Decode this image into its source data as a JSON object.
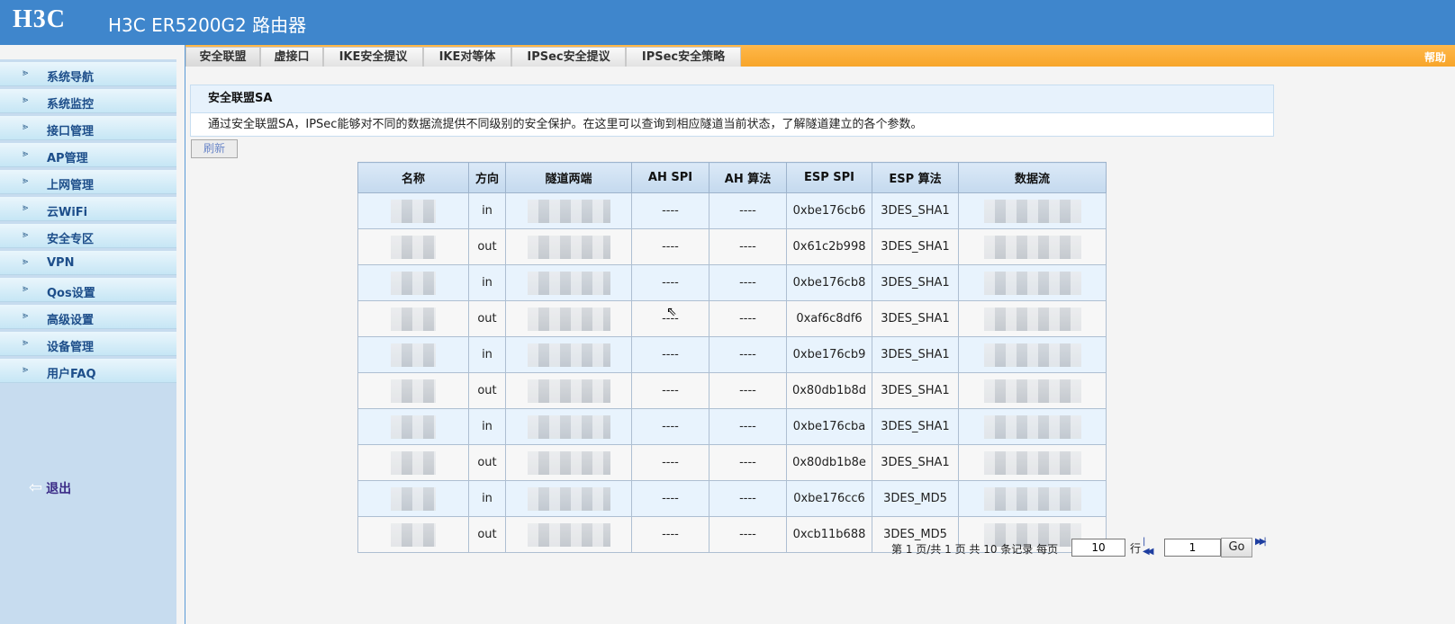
{
  "header": {
    "logo": "H3C",
    "title": "H3C ER5200G2 路由器"
  },
  "sidebar": {
    "items": [
      {
        "label": "系统导航"
      },
      {
        "label": "系统监控"
      },
      {
        "label": "接口管理"
      },
      {
        "label": "AP管理"
      },
      {
        "label": "上网管理"
      },
      {
        "label": "云WiFi"
      },
      {
        "label": "安全专区"
      },
      {
        "label": "VPN"
      },
      {
        "label": "Qos设置"
      },
      {
        "label": "高级设置"
      },
      {
        "label": "设备管理"
      },
      {
        "label": "用户FAQ"
      }
    ],
    "logout_label": "退出",
    "logout_icon": "logout-icon"
  },
  "tabs": {
    "items": [
      {
        "label": "安全联盟",
        "active": true
      },
      {
        "label": "虚接口"
      },
      {
        "label": "IKE安全提议"
      },
      {
        "label": "IKE对等体"
      },
      {
        "label": "IPSec安全提议"
      },
      {
        "label": "IPSec安全策略"
      }
    ],
    "help": "帮助"
  },
  "sa": {
    "title": "安全联盟SA",
    "description": "通过安全联盟SA，IPSec能够对不同的数据流提供不同级别的安全保护。在这里可以查询到相应隧道当前状态，了解隧道建立的各个参数。",
    "refresh": "刷新"
  },
  "table": {
    "headers": [
      "名称",
      "方向",
      "隧道两端",
      "AH SPI",
      "AH 算法",
      "ESP SPI",
      "ESP 算法",
      "数据流"
    ],
    "rows": [
      {
        "direction": "in",
        "ah_spi": "----",
        "ah_alg": "----",
        "esp_spi": "0xbe176cb6",
        "esp_alg": "3DES_SHA1"
      },
      {
        "direction": "out",
        "ah_spi": "----",
        "ah_alg": "----",
        "esp_spi": "0x61c2b998",
        "esp_alg": "3DES_SHA1"
      },
      {
        "direction": "in",
        "ah_spi": "----",
        "ah_alg": "----",
        "esp_spi": "0xbe176cb8",
        "esp_alg": "3DES_SHA1"
      },
      {
        "direction": "out",
        "ah_spi": "----",
        "ah_alg": "----",
        "esp_spi": "0xaf6c8df6",
        "esp_alg": "3DES_SHA1"
      },
      {
        "direction": "in",
        "ah_spi": "----",
        "ah_alg": "----",
        "esp_spi": "0xbe176cb9",
        "esp_alg": "3DES_SHA1"
      },
      {
        "direction": "out",
        "ah_spi": "----",
        "ah_alg": "----",
        "esp_spi": "0x80db1b8d",
        "esp_alg": "3DES_SHA1"
      },
      {
        "direction": "in",
        "ah_spi": "----",
        "ah_alg": "----",
        "esp_spi": "0xbe176cba",
        "esp_alg": "3DES_SHA1"
      },
      {
        "direction": "out",
        "ah_spi": "----",
        "ah_alg": "----",
        "esp_spi": "0x80db1b8e",
        "esp_alg": "3DES_SHA1"
      },
      {
        "direction": "in",
        "ah_spi": "----",
        "ah_alg": "----",
        "esp_spi": "0xbe176cc6",
        "esp_alg": "3DES_MD5"
      },
      {
        "direction": "out",
        "ah_spi": "----",
        "ah_alg": "----",
        "esp_spi": "0xcb11b688",
        "esp_alg": "3DES_MD5"
      }
    ]
  },
  "pager": {
    "summary": "第 1 页/共 1 页 共 10 条记录 每页",
    "per_page": "10",
    "per_page_unit": "行",
    "page": "1",
    "go": "Go"
  },
  "colors": {
    "header_bg": "#3f86cc",
    "tabbar_bg": "#f7a52a",
    "sidebar_bg": "#c7dcef"
  }
}
